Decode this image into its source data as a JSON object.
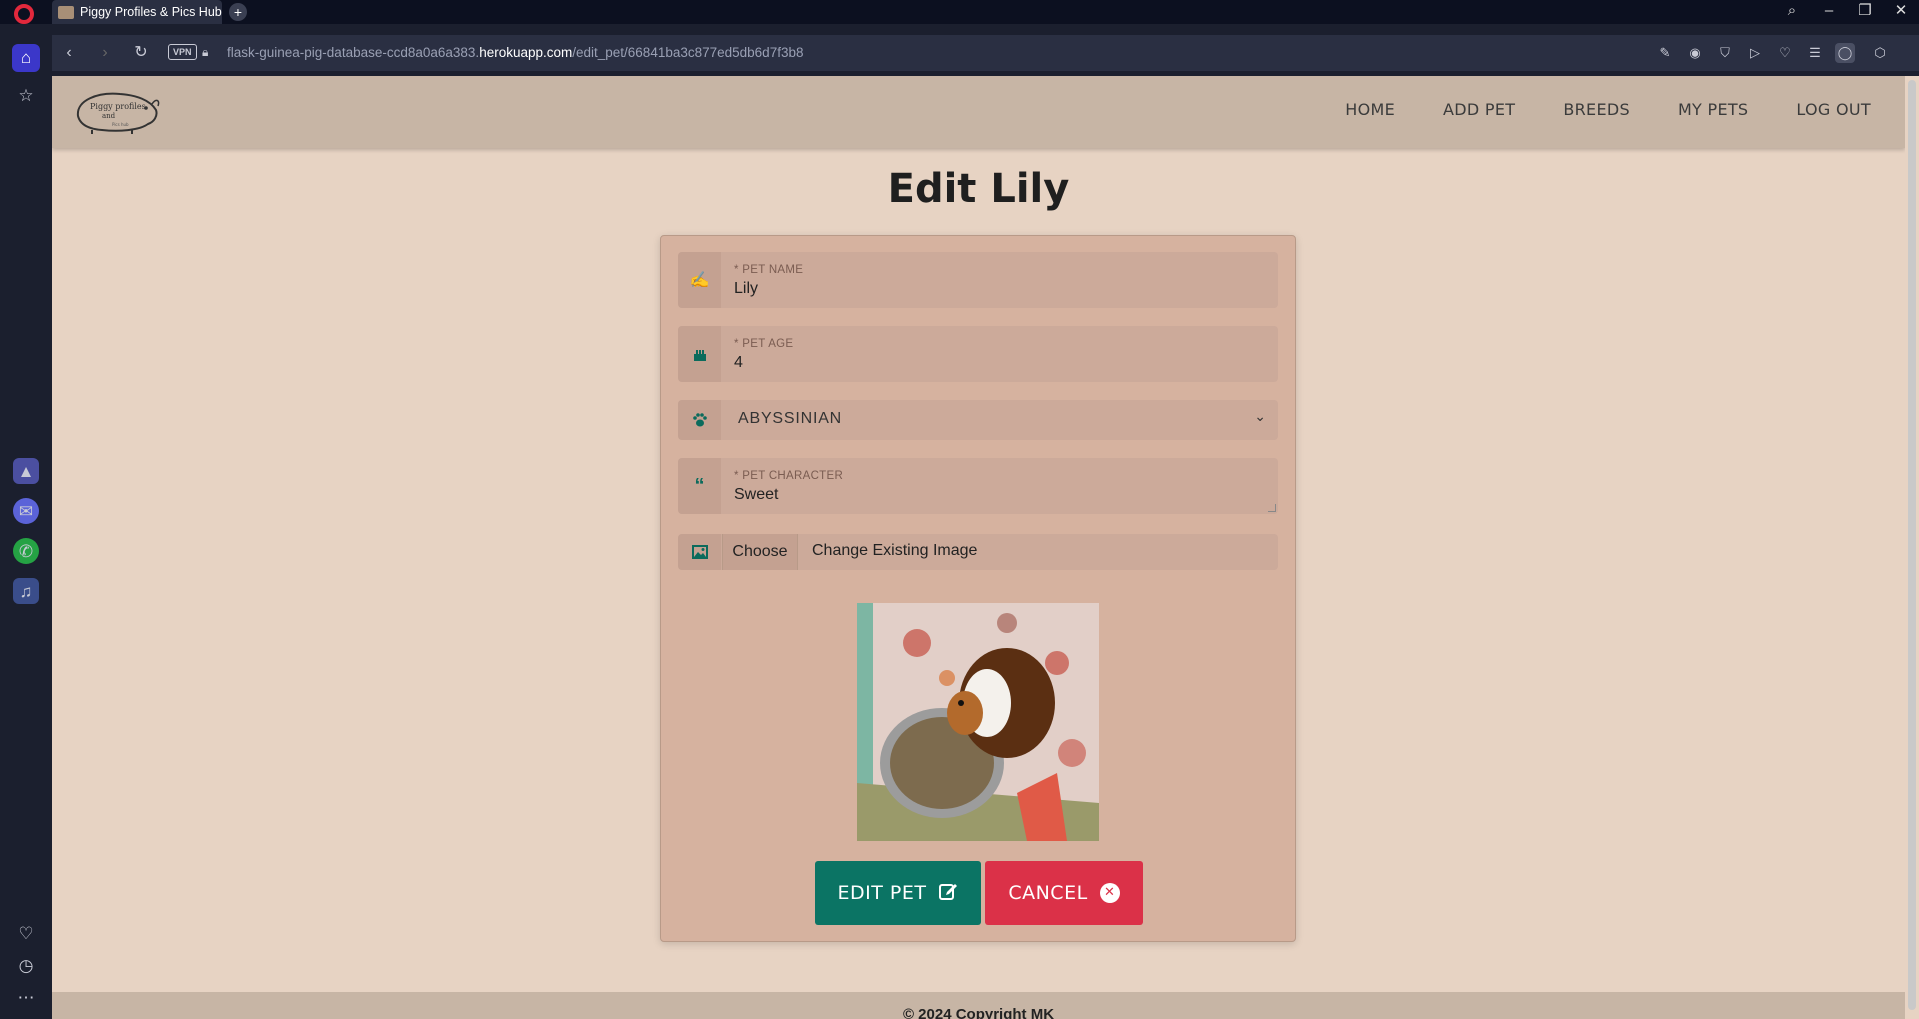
{
  "browser": {
    "tab_title": "Piggy Profiles & Pics Hub",
    "new_tab": "+",
    "url_prefix": "flask-guinea-pig-database-ccd8a0a6a383.",
    "url_host": "herokuapp.com",
    "url_path": "/edit_pet/66841ba3c877ed5db6d7f3b8",
    "vpn_label": "VPN"
  },
  "site": {
    "logo_line1": "Piggy profiles",
    "logo_line2": "and",
    "logo_line3": "Pics hub",
    "nav": [
      "HOME",
      "ADD PET",
      "BREEDS",
      "MY PETS",
      "LOG OUT"
    ]
  },
  "form": {
    "title": "Edit Lily",
    "name_label": "* PET NAME",
    "name_value": "Lily",
    "age_label": "* PET AGE",
    "age_value": "4",
    "breed_value": "ABYSSINIAN",
    "character_label": "* PET CHARACTER",
    "character_value": "Sweet",
    "file_button": "Choose",
    "file_text": "Change Existing Image",
    "edit_button": "EDIT PET",
    "cancel_button": "CANCEL"
  },
  "footer": {
    "text": "© 2024 Copyright MK"
  },
  "colors": {
    "page_bg": "#e7d3c3",
    "navbar_bg": "#c7b5a5",
    "card_bg": "#d6b29f",
    "accent_green": "#0b7464",
    "accent_red": "#db3148"
  }
}
